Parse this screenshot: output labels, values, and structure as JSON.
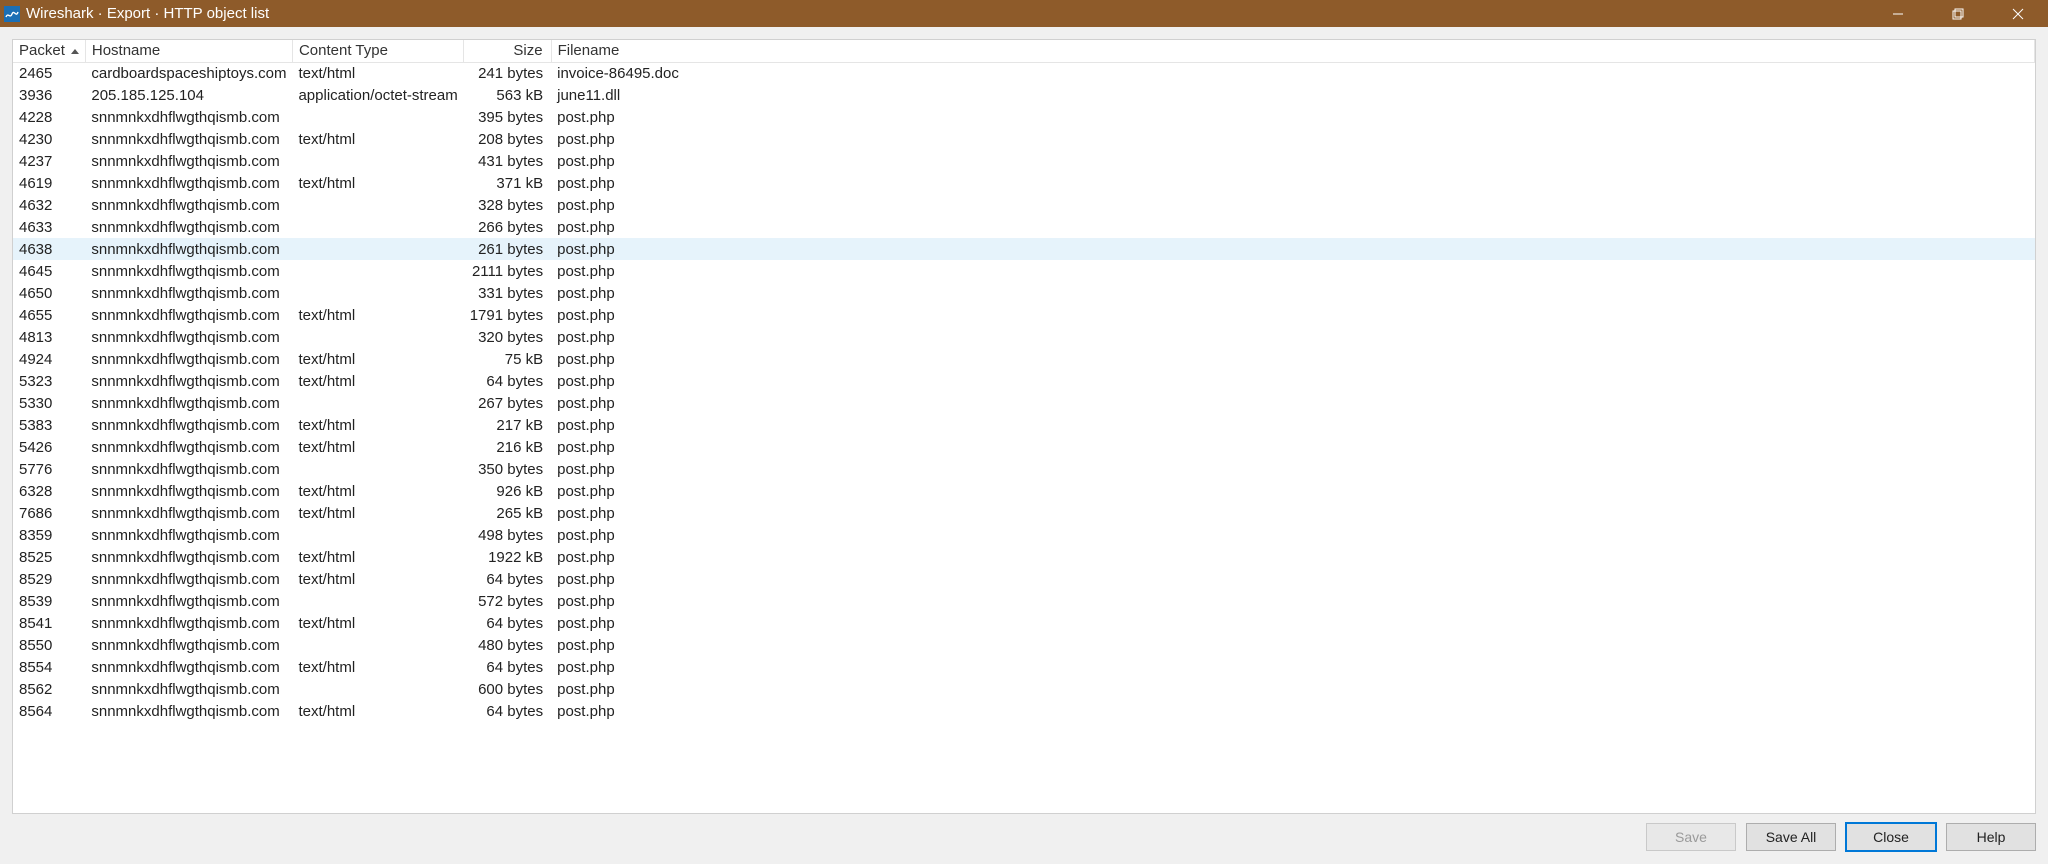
{
  "window": {
    "title": "Wireshark · Export · HTTP object list"
  },
  "columns": {
    "packet": "Packet",
    "hostname": "Hostname",
    "ctype": "Content Type",
    "size": "Size",
    "filename": "Filename"
  },
  "selected_packet": "4638",
  "rows": [
    {
      "packet": "2465",
      "hostname": "cardboardspaceshiptoys.com",
      "ctype": "text/html",
      "size": "241 bytes",
      "filename": "invoice-86495.doc"
    },
    {
      "packet": "3936",
      "hostname": "205.185.125.104",
      "ctype": "application/octet-stream",
      "size": "563 kB",
      "filename": "june11.dll"
    },
    {
      "packet": "4228",
      "hostname": "snnmnkxdhflwgthqismb.com",
      "ctype": "",
      "size": "395 bytes",
      "filename": "post.php"
    },
    {
      "packet": "4230",
      "hostname": "snnmnkxdhflwgthqismb.com",
      "ctype": "text/html",
      "size": "208 bytes",
      "filename": "post.php"
    },
    {
      "packet": "4237",
      "hostname": "snnmnkxdhflwgthqismb.com",
      "ctype": "",
      "size": "431 bytes",
      "filename": "post.php"
    },
    {
      "packet": "4619",
      "hostname": "snnmnkxdhflwgthqismb.com",
      "ctype": "text/html",
      "size": "371 kB",
      "filename": "post.php"
    },
    {
      "packet": "4632",
      "hostname": "snnmnkxdhflwgthqismb.com",
      "ctype": "",
      "size": "328 bytes",
      "filename": "post.php"
    },
    {
      "packet": "4633",
      "hostname": "snnmnkxdhflwgthqismb.com",
      "ctype": "",
      "size": "266 bytes",
      "filename": "post.php"
    },
    {
      "packet": "4638",
      "hostname": "snnmnkxdhflwgthqismb.com",
      "ctype": "",
      "size": "261 bytes",
      "filename": "post.php"
    },
    {
      "packet": "4645",
      "hostname": "snnmnkxdhflwgthqismb.com",
      "ctype": "",
      "size": "2111 bytes",
      "filename": "post.php"
    },
    {
      "packet": "4650",
      "hostname": "snnmnkxdhflwgthqismb.com",
      "ctype": "",
      "size": "331 bytes",
      "filename": "post.php"
    },
    {
      "packet": "4655",
      "hostname": "snnmnkxdhflwgthqismb.com",
      "ctype": "text/html",
      "size": "1791 bytes",
      "filename": "post.php"
    },
    {
      "packet": "4813",
      "hostname": "snnmnkxdhflwgthqismb.com",
      "ctype": "",
      "size": "320 bytes",
      "filename": "post.php"
    },
    {
      "packet": "4924",
      "hostname": "snnmnkxdhflwgthqismb.com",
      "ctype": "text/html",
      "size": "75 kB",
      "filename": "post.php"
    },
    {
      "packet": "5323",
      "hostname": "snnmnkxdhflwgthqismb.com",
      "ctype": "text/html",
      "size": "64 bytes",
      "filename": "post.php"
    },
    {
      "packet": "5330",
      "hostname": "snnmnkxdhflwgthqismb.com",
      "ctype": "",
      "size": "267 bytes",
      "filename": "post.php"
    },
    {
      "packet": "5383",
      "hostname": "snnmnkxdhflwgthqismb.com",
      "ctype": "text/html",
      "size": "217 kB",
      "filename": "post.php"
    },
    {
      "packet": "5426",
      "hostname": "snnmnkxdhflwgthqismb.com",
      "ctype": "text/html",
      "size": "216 kB",
      "filename": "post.php"
    },
    {
      "packet": "5776",
      "hostname": "snnmnkxdhflwgthqismb.com",
      "ctype": "",
      "size": "350 bytes",
      "filename": "post.php"
    },
    {
      "packet": "6328",
      "hostname": "snnmnkxdhflwgthqismb.com",
      "ctype": "text/html",
      "size": "926 kB",
      "filename": "post.php"
    },
    {
      "packet": "7686",
      "hostname": "snnmnkxdhflwgthqismb.com",
      "ctype": "text/html",
      "size": "265 kB",
      "filename": "post.php"
    },
    {
      "packet": "8359",
      "hostname": "snnmnkxdhflwgthqismb.com",
      "ctype": "",
      "size": "498 bytes",
      "filename": "post.php"
    },
    {
      "packet": "8525",
      "hostname": "snnmnkxdhflwgthqismb.com",
      "ctype": "text/html",
      "size": "1922 kB",
      "filename": "post.php"
    },
    {
      "packet": "8529",
      "hostname": "snnmnkxdhflwgthqismb.com",
      "ctype": "text/html",
      "size": "64 bytes",
      "filename": "post.php"
    },
    {
      "packet": "8539",
      "hostname": "snnmnkxdhflwgthqismb.com",
      "ctype": "",
      "size": "572 bytes",
      "filename": "post.php"
    },
    {
      "packet": "8541",
      "hostname": "snnmnkxdhflwgthqismb.com",
      "ctype": "text/html",
      "size": "64 bytes",
      "filename": "post.php"
    },
    {
      "packet": "8550",
      "hostname": "snnmnkxdhflwgthqismb.com",
      "ctype": "",
      "size": "480 bytes",
      "filename": "post.php"
    },
    {
      "packet": "8554",
      "hostname": "snnmnkxdhflwgthqismb.com",
      "ctype": "text/html",
      "size": "64 bytes",
      "filename": "post.php"
    },
    {
      "packet": "8562",
      "hostname": "snnmnkxdhflwgthqismb.com",
      "ctype": "",
      "size": "600 bytes",
      "filename": "post.php"
    },
    {
      "packet": "8564",
      "hostname": "snnmnkxdhflwgthqismb.com",
      "ctype": "text/html",
      "size": "64 bytes",
      "filename": "post.php"
    }
  ],
  "buttons": {
    "save": "Save",
    "saveall": "Save All",
    "close": "Close",
    "help": "Help"
  }
}
